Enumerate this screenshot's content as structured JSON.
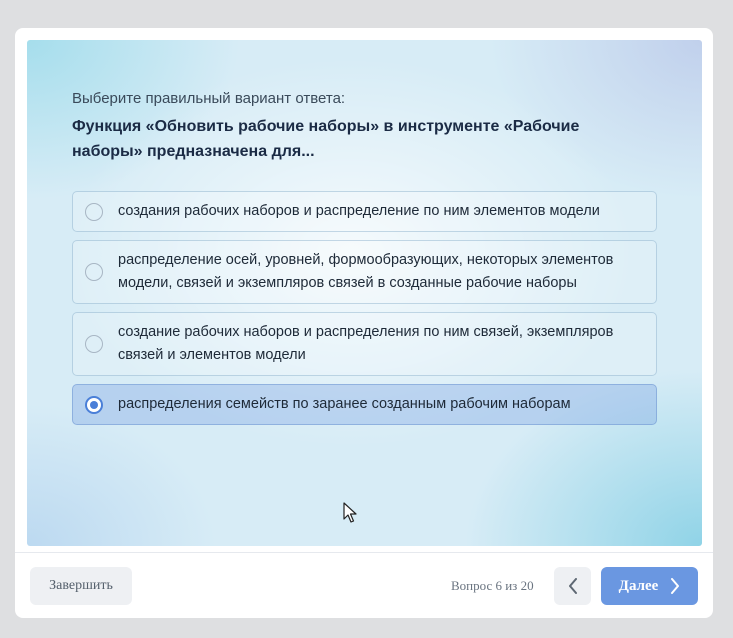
{
  "quiz": {
    "prompt": "Выберите правильный вариант ответа:",
    "question": "Функция «Обновить рабочие наборы» в инструменте «Рабочие наборы» предназначена для...",
    "options": [
      {
        "label": "создания рабочих наборов и распределение по ним элементов модели",
        "selected": false
      },
      {
        "label": "распределение осей, уровней, формообразующих, некоторых элементов модели, связей и экземпляров связей в созданные рабочие наборы",
        "selected": false
      },
      {
        "label": "создание рабочих наборов и распределения по ним связей, экземпляров связей и элементов модели",
        "selected": false
      },
      {
        "label": "распределения семейств по заранее созданным рабочим наборам",
        "selected": true
      }
    ]
  },
  "footer": {
    "finish_label": "Завершить",
    "counter": "Вопрос 6 из 20",
    "next_label": "Далее",
    "prev_icon": "chevron-left-icon",
    "next_icon": "chevron-right-icon"
  },
  "colors": {
    "accent": "#6a97e1",
    "radio_selected": "#4a7fd8",
    "selected_option_bg": "#b6cbef"
  }
}
